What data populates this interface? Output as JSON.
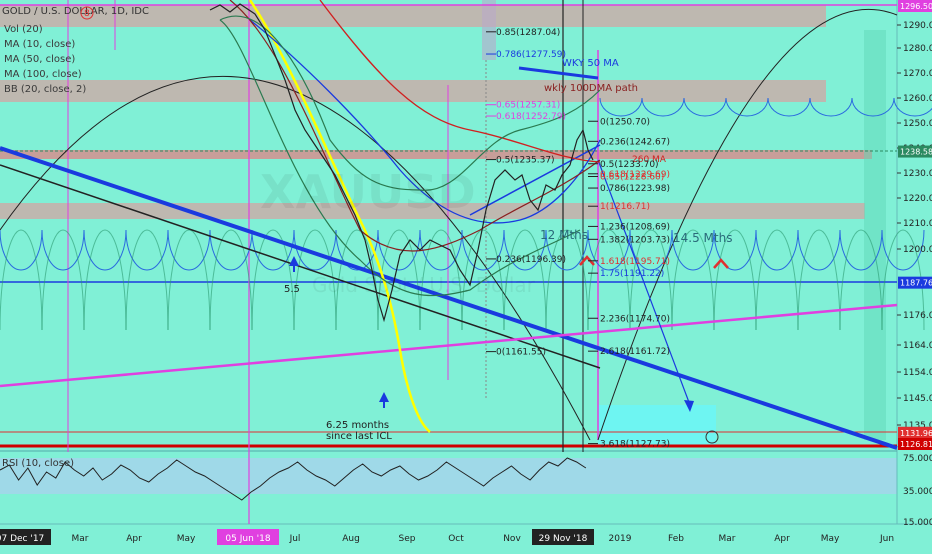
{
  "header": {
    "symbol_line": "GOLD / U.S. DOLLAR, 1D, IDC",
    "indicators": [
      "Vol (20)",
      "MA (10, close)",
      "MA (50, close)",
      "MA (100, close)",
      "BB (20, close, 2)"
    ],
    "badge": "8"
  },
  "watermark": {
    "symbol": "XAUUSD",
    "subtitle": "Gold Spot / U.S. Dollar"
  },
  "rsi_legend": "RSI (10, close)",
  "chart_data": {
    "type": "line",
    "title": "GOLD / U.S. DOLLAR, 1D, IDC",
    "price_axis": {
      "ticks": [
        1290,
        1280,
        1270,
        1260,
        1250,
        1240,
        1230,
        1220,
        1210,
        1200,
        1176,
        1164,
        1154,
        1145,
        1135
      ],
      "labels": [
        "1290.00",
        "1280.00",
        "1270.00",
        "1260.00",
        "1250.00",
        "1240.00",
        "1230.00",
        "1220.00",
        "1210.00",
        "1200.00",
        "1176.00",
        "1164.00",
        "1154.00",
        "1145.00",
        "1135.00"
      ],
      "ylim": [
        1126,
        1298
      ],
      "highlighted": [
        {
          "value": 1296.5,
          "label": "1296.50",
          "color": "#e040e0"
        },
        {
          "value": 1238.58,
          "label": "1238.58",
          "color": "#2a8a60"
        },
        {
          "value": 1187.76,
          "label": "1187.76",
          "color": "#1a3adf"
        },
        {
          "value": 1131.96,
          "label": "1131.96",
          "color": "#e03030"
        },
        {
          "value": 1126.81,
          "label": "1126.81",
          "color": "#d00000"
        }
      ]
    },
    "rsi_axis": {
      "labels": [
        "75.0000",
        "35.0000",
        "15.0000"
      ],
      "values": [
        75,
        35,
        15
      ],
      "ylim": [
        10,
        80
      ]
    },
    "time_axis": {
      "labels": [
        "07 Dec '17",
        "Mar",
        "Apr",
        "May",
        "05 Jun '18",
        "Jul",
        "Aug",
        "Sep",
        "Oct",
        "Nov",
        "29 Nov '18",
        "2019",
        "Feb",
        "Mar",
        "Apr",
        "May",
        "Jun"
      ],
      "highlighted": [
        "07 Dec '17",
        "05 Jun '18",
        "29 Nov '18"
      ]
    },
    "fib_levels_upper": [
      {
        "label": "0.85(1287.04)",
        "value": 1287.04
      },
      {
        "label": "0.786(1277.59)",
        "value": 1277.59
      },
      {
        "label": "0.65(1257.31)",
        "value": 1257.31
      },
      {
        "label": "0.618(1252.79)",
        "value": 1252.79
      },
      {
        "label": "0.5(1235.37)",
        "value": 1235.37
      },
      {
        "label": "0.236(1196.39)",
        "value": 1196.39
      },
      {
        "label": "0(1161.55)",
        "value": 1161.55
      }
    ],
    "fib_levels_right": [
      {
        "label": "0(1250.70)",
        "value": 1250.7
      },
      {
        "label": "0.236(1242.67)",
        "value": 1242.67
      },
      {
        "label": "0.5(1233.70)",
        "value": 1233.7
      },
      {
        "label": "0.618(1229.69)",
        "value": 1229.69
      },
      {
        "label": "0.65(1228.60)",
        "value": 1228.6
      },
      {
        "label": "0.786(1223.98)",
        "value": 1223.98
      },
      {
        "label": "1(1216.71)",
        "value": 1216.71
      },
      {
        "label": "1.236(1208.69)",
        "value": 1208.69
      },
      {
        "label": "1.382(1203.73)",
        "value": 1203.73
      },
      {
        "label": "1.618(1195.71)",
        "value": 1195.71
      },
      {
        "label": "1.75(1191.22)",
        "value": 1191.22
      },
      {
        "label": "2.236(1174.70)",
        "value": 1174.7
      },
      {
        "label": "2.618(1161.72)",
        "value": 1161.72
      },
      {
        "label": "3.618(1127.73)",
        "value": 1127.73
      }
    ],
    "annotations": [
      "WKY 50 MA",
      "wkly 100DMA path",
      "12 Mths",
      "14.5 Mths",
      "5.5",
      "6.25 months",
      "since last ICL",
      "260 MA"
    ]
  }
}
